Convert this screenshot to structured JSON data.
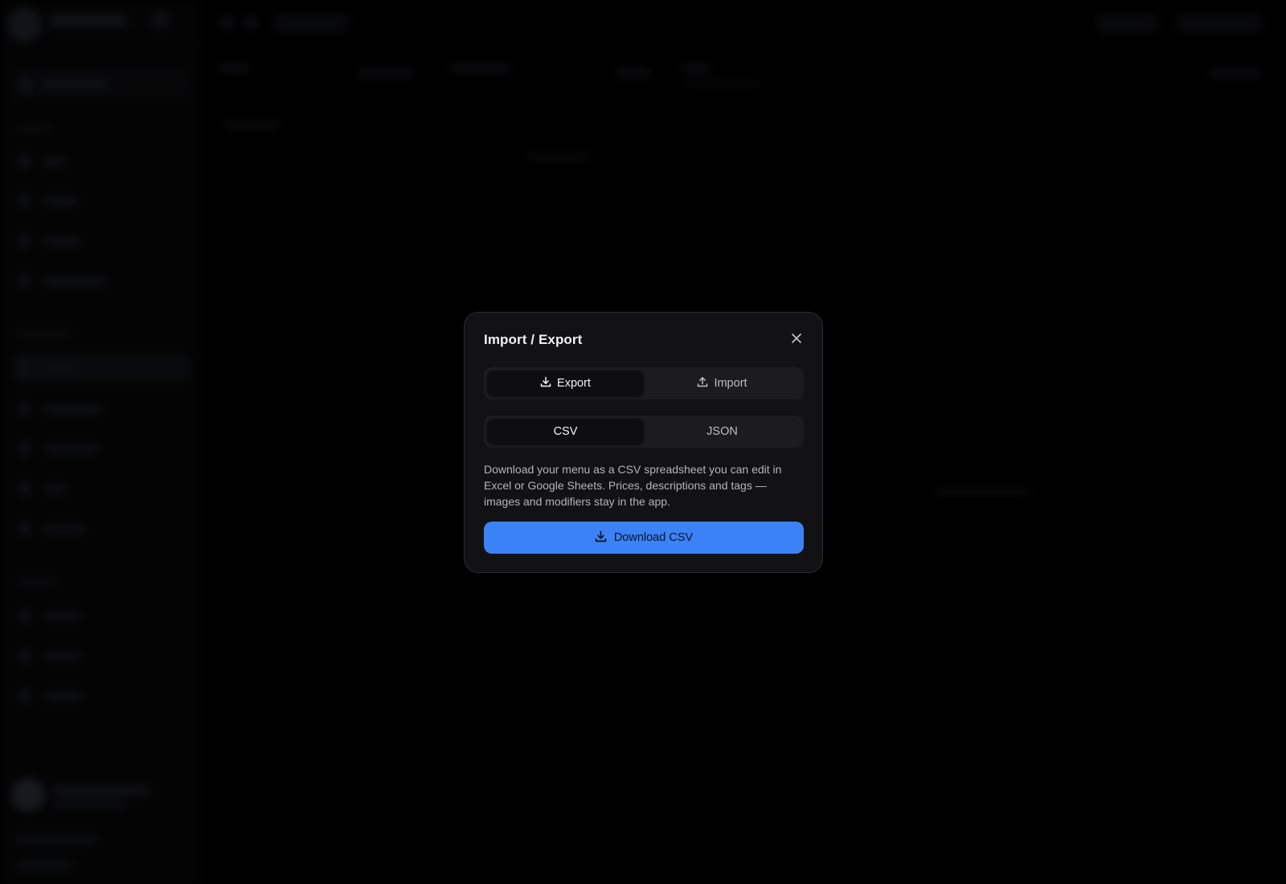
{
  "modal": {
    "title": "Import / Export",
    "close_icon": "close-icon",
    "tabs": [
      {
        "label": "Export",
        "icon": "download-icon",
        "active": true
      },
      {
        "label": "Import",
        "icon": "upload-icon",
        "active": false
      }
    ],
    "formats": [
      {
        "label": "CSV",
        "active": true
      },
      {
        "label": "JSON",
        "active": false
      }
    ],
    "description": "Download your menu as a CSV spreadsheet you can edit in Excel or Google Sheets. Prices, descriptions and tags — images and modifiers stay in the app.",
    "download_label": "Download CSV",
    "download_icon": "download-icon"
  },
  "colors": {
    "accent": "#3b82f6",
    "modal_bg": "#121214",
    "page_bg": "#000000"
  }
}
